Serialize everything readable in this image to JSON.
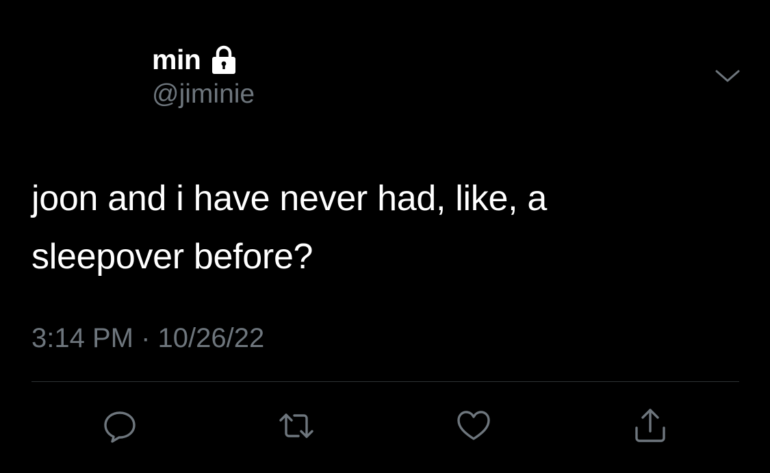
{
  "tweet": {
    "display_name": "min",
    "handle": "@jiminie",
    "text_lines": [
      "joon and i have never had, like, a",
      "sleepover before?"
    ],
    "time": "3:14 PM",
    "separator": "·",
    "date": "10/26/22"
  },
  "icons": {
    "lock": "lock-icon",
    "caret": "chevron-down-icon",
    "reply": "reply-icon",
    "retweet": "retweet-icon",
    "like": "heart-icon",
    "share": "share-icon"
  },
  "colors": {
    "background": "#000000",
    "text": "#ffffff",
    "secondary": "#6e767d",
    "divider": "#2f3336"
  }
}
